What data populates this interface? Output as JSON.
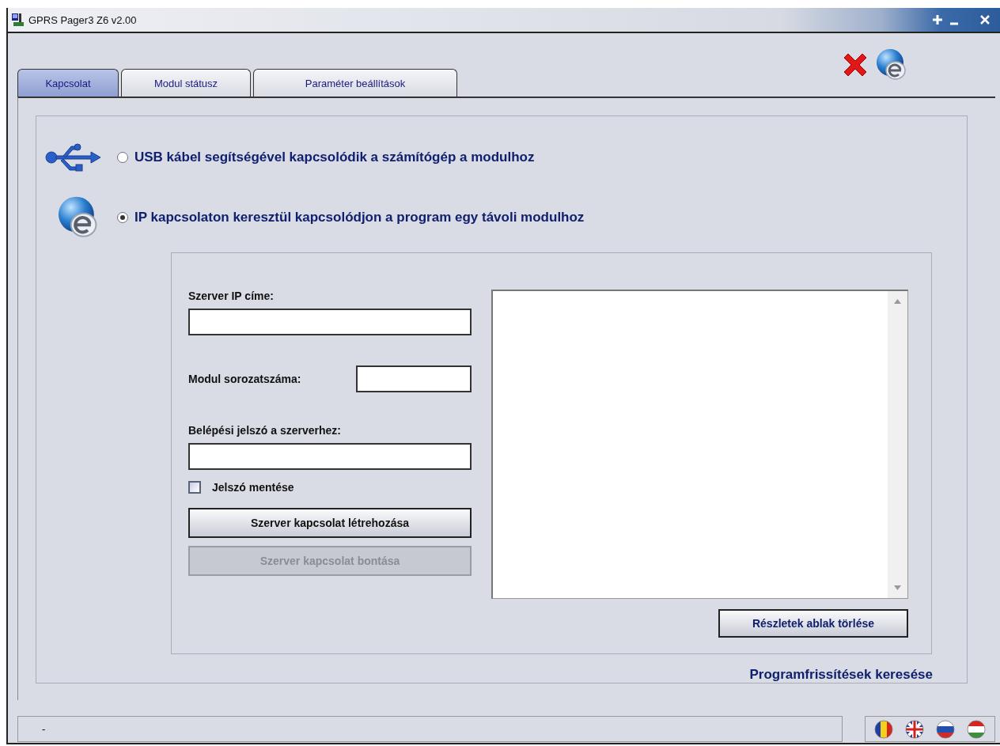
{
  "window": {
    "title": "GPRS Pager3 Z6 v2.00"
  },
  "tabs": [
    {
      "label": "Kapcsolat",
      "selected": true
    },
    {
      "label": "Modul státusz",
      "selected": false
    },
    {
      "label": "Paraméter beállítások",
      "selected": false
    }
  ],
  "connection_options": [
    {
      "kind": "usb",
      "label": "USB kábel segítségével kapcsolódik a számítógép a modulhoz",
      "selected": false
    },
    {
      "kind": "ip",
      "label": "IP kapcsolaton keresztül kapcsolódjon a program egy távoli modulhoz",
      "selected": true
    }
  ],
  "server_form": {
    "fields": [
      {
        "kind": "wide",
        "label": "Szerver IP címe:"
      },
      {
        "kind": "inline",
        "label": "Modul sorozatszáma:"
      },
      {
        "kind": "wide",
        "label": "Belépési jelszó a szerverhez:"
      }
    ],
    "save_password": {
      "label": "Jelszó mentése",
      "checked": false
    },
    "buttons": [
      {
        "label": "Szerver kapcsolat létrehozása",
        "disabled": false
      },
      {
        "label": "Szerver kapcsolat bontása",
        "disabled": true
      }
    ]
  },
  "details": {
    "clear_button": "Részletek ablak törlése"
  },
  "update_link": "Programfrissítések keresése",
  "status_bar": {
    "text": "-"
  }
}
